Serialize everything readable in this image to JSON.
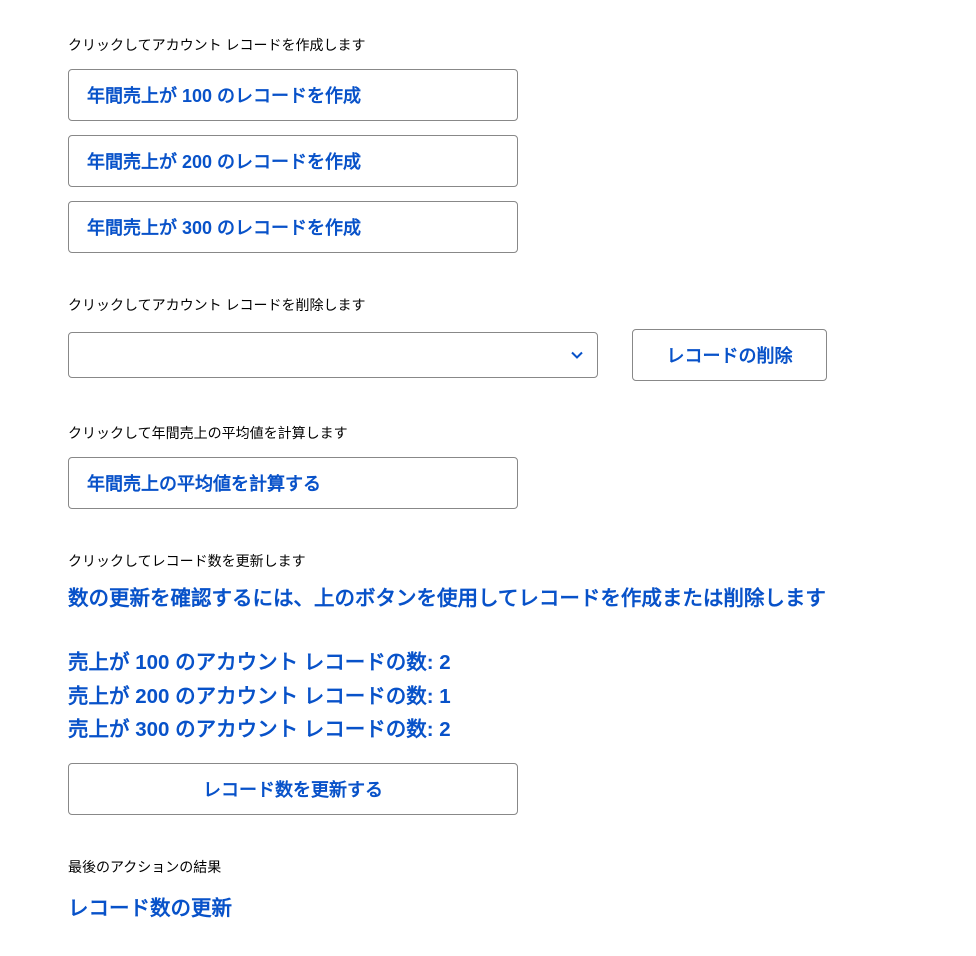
{
  "create": {
    "label": "クリックしてアカウント レコードを作成します",
    "buttons": [
      "年間売上が 100 のレコードを作成",
      "年間売上が 200 のレコードを作成",
      "年間売上が 300 のレコードを作成"
    ]
  },
  "delete": {
    "label": "クリックしてアカウント レコードを削除します",
    "button": "レコードの削除"
  },
  "calculate": {
    "label": "クリックして年間売上の平均値を計算します",
    "button": "年間売上の平均値を計算する"
  },
  "refresh": {
    "label": "クリックしてレコード数を更新します",
    "info": "数の更新を確認するには、上のボタンを使用してレコードを作成または削除します",
    "counts": [
      "売上が 100 のアカウント レコードの数: 2",
      "売上が 200 のアカウント レコードの数: 1",
      "売上が 300 のアカウント レコードの数: 2"
    ],
    "button": "レコード数を更新する"
  },
  "result": {
    "label": "最後のアクションの結果",
    "text": "レコード数の更新"
  }
}
